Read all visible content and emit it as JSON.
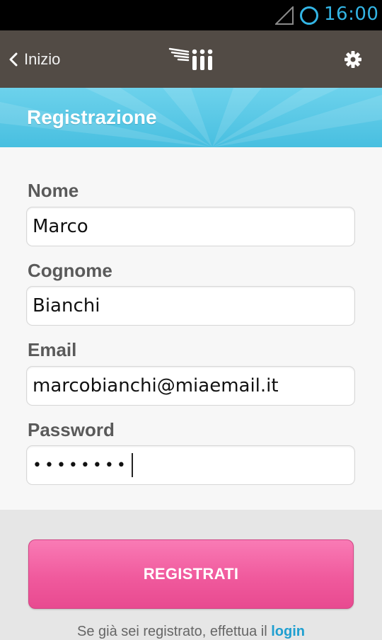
{
  "status_bar": {
    "time": "16:00",
    "icons": [
      "signal-icon",
      "alarm-icon"
    ]
  },
  "action_bar": {
    "back_label": "Inizio",
    "back_icon": "chevron-left-icon",
    "logo_icon": "winged-logo-icon",
    "settings_icon": "gear-icon"
  },
  "header": {
    "title": "Registrazione"
  },
  "form": {
    "fields": [
      {
        "label": "Nome",
        "value": "Marco"
      },
      {
        "label": "Cognome",
        "value": "Bianchi"
      },
      {
        "label": "Email",
        "value": "marcobianchi@miaemail.it"
      },
      {
        "label": "Password",
        "value": "••••••••"
      }
    ]
  },
  "actions": {
    "register_label": "REGISTRATI"
  },
  "footer": {
    "prefix": "Se già sei registrato, effettua il ",
    "link": "login"
  },
  "colors": {
    "status_accent": "#33b5e5",
    "action_bar": "#524b45",
    "banner": "#48bfe0",
    "button": "#f05a9d",
    "link": "#1f9fd0"
  }
}
